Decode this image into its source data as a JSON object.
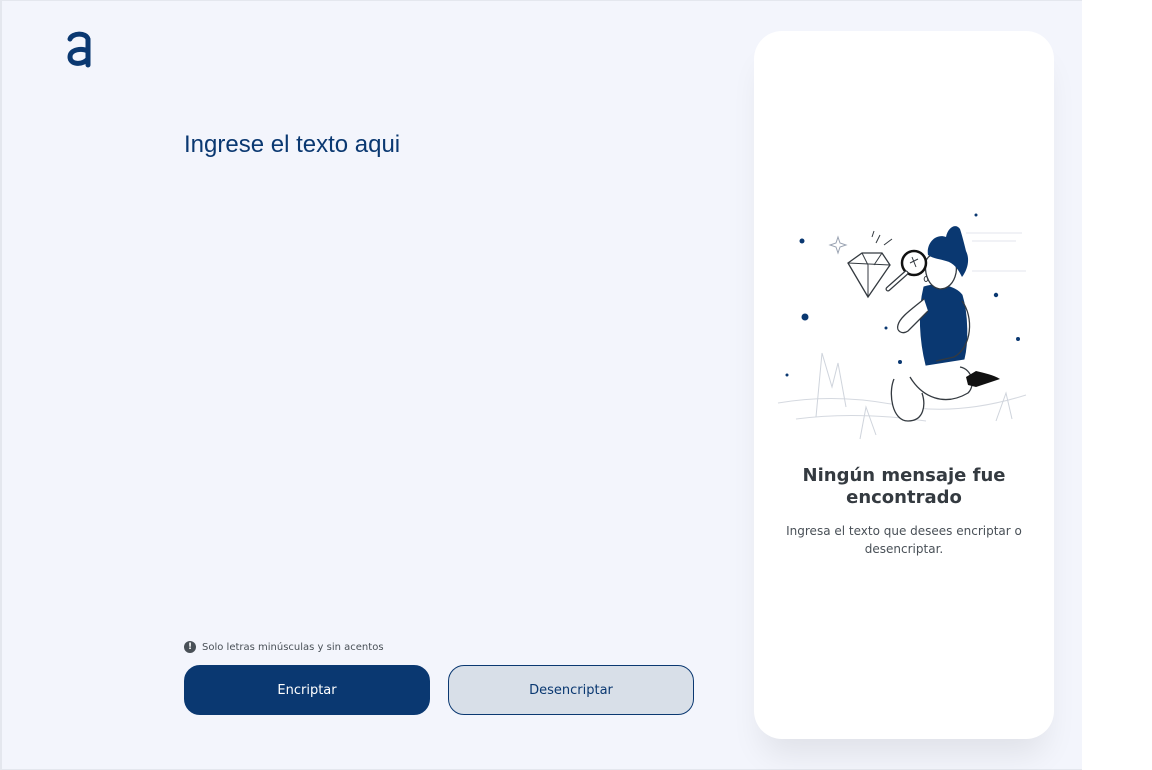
{
  "header": {
    "logo_icon": "alura-a-logo-icon"
  },
  "editor": {
    "placeholder": "Ingrese el texto aqui",
    "value": ""
  },
  "hint": {
    "icon": "exclamation-circle-icon",
    "text": "Solo letras minúsculas y sin acentos"
  },
  "actions": {
    "encrypt_label": "Encriptar",
    "decrypt_label": "Desencriptar"
  },
  "output": {
    "illustration": "person-with-magnifying-glass-illustration",
    "title": "Ningún mensaje fue encontrado",
    "description": "Ingresa el texto que desees encriptar o desencriptar."
  },
  "colors": {
    "background": "#f3f5fc",
    "primary": "#0a3871",
    "secondary_fill": "#d8dfe8",
    "card": "#ffffff",
    "title_text": "#343a40",
    "body_text": "#495057"
  }
}
